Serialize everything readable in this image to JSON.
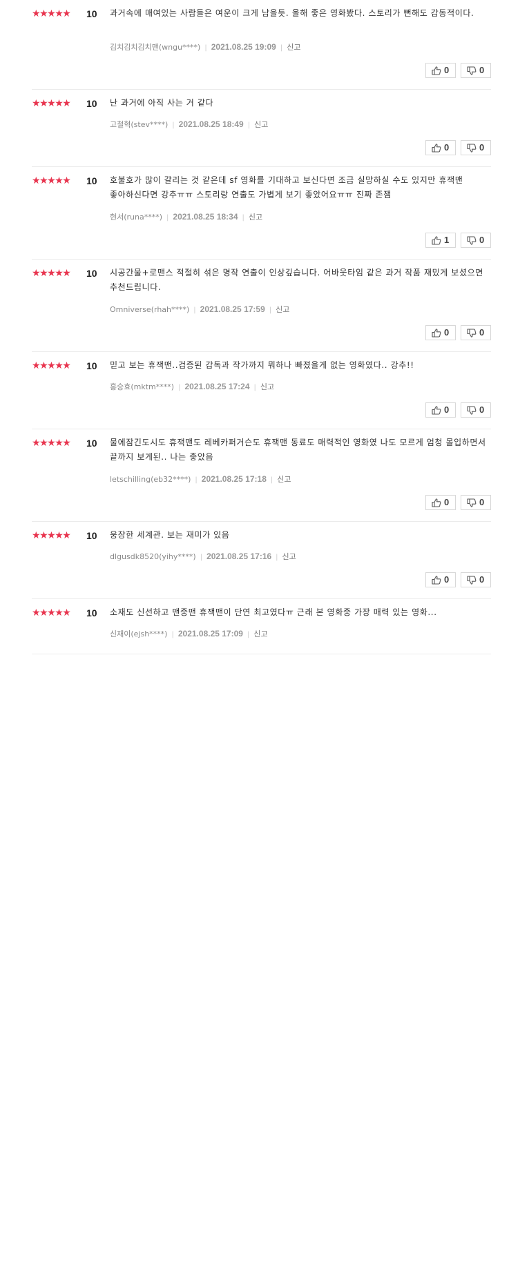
{
  "rating_max": 5,
  "labels": {
    "report": "신고"
  },
  "icons": {
    "star": "star-icon",
    "like": "thumbs-up-icon",
    "dislike": "thumbs-down-icon"
  },
  "colors": {
    "star": "#e8344e"
  },
  "reviews": [
    {
      "stars": 5,
      "score": "10",
      "text": "과거속에 매여있는 사람들은 여운이 크게 남을듯. 올해 좋은 영화봤다. 스토리가 뻔해도 감동적이다.",
      "author": "김치김치김치맨(wngu****)",
      "date": "2021.08.25 19:09",
      "likes": "0",
      "dislikes": "0"
    },
    {
      "stars": 5,
      "score": "10",
      "text": "난 과거에 아직 사는 거 같다",
      "author": "고철혁(stev****)",
      "date": "2021.08.25 18:49",
      "likes": "0",
      "dislikes": "0"
    },
    {
      "stars": 5,
      "score": "10",
      "text": "호불호가 많이 갈리는 것 같은데 sf 영화를 기대하고 보신다면 조금 실망하실 수도 있지만 휴잭맨 좋아하신다면 강추ㅠㅠ 스토리랑 연출도 가볍게 보기 좋았어요ㅠㅠ 진짜 존잼",
      "author": "현서(runa****)",
      "date": "2021.08.25 18:34",
      "likes": "1",
      "dislikes": "0"
    },
    {
      "stars": 5,
      "score": "10",
      "text": "시공간물+로맨스 적절히 섞은 명작 연출이 인상깊습니다. 어바웃타임 같은 과거 작품 재밌게 보셨으면 추천드립니다.",
      "author": "Omniverse(rhah****)",
      "date": "2021.08.25 17:59",
      "likes": "0",
      "dislikes": "0"
    },
    {
      "stars": 5,
      "score": "10",
      "text": "믿고 보는 휴잭맨..검증된 감독과 작가까지 뭐하나 빠졌을게 없는 영화였다.. 강추!!",
      "author": "홍승효(mktm****)",
      "date": "2021.08.25 17:24",
      "likes": "0",
      "dislikes": "0"
    },
    {
      "stars": 5,
      "score": "10",
      "text": "물에잠긴도시도 휴잭맨도 레베카퍼거슨도 휴잭맨 동료도 매력적인 영화였 나도 모르게 엄청 몰입하면서 끝까지 보게된.. 나는 좋았음",
      "author": "letschilling(eb32****)",
      "date": "2021.08.25 17:18",
      "likes": "0",
      "dislikes": "0"
    },
    {
      "stars": 5,
      "score": "10",
      "text": "웅장한 세계관. 보는 재미가 있음",
      "author": "dlgusdk8520(yihy****)",
      "date": "2021.08.25 17:16",
      "likes": "0",
      "dislikes": "0"
    },
    {
      "stars": 5,
      "score": "10",
      "text": "소재도 신선하고 맨중맨 휴잭맨이 단연 최고였다ㅠ 근래 본 영화중 가장 매력 있는 영화...",
      "author": "신재이(ejsh****)",
      "date": "2021.08.25 17:09",
      "likes": "",
      "dislikes": ""
    }
  ]
}
